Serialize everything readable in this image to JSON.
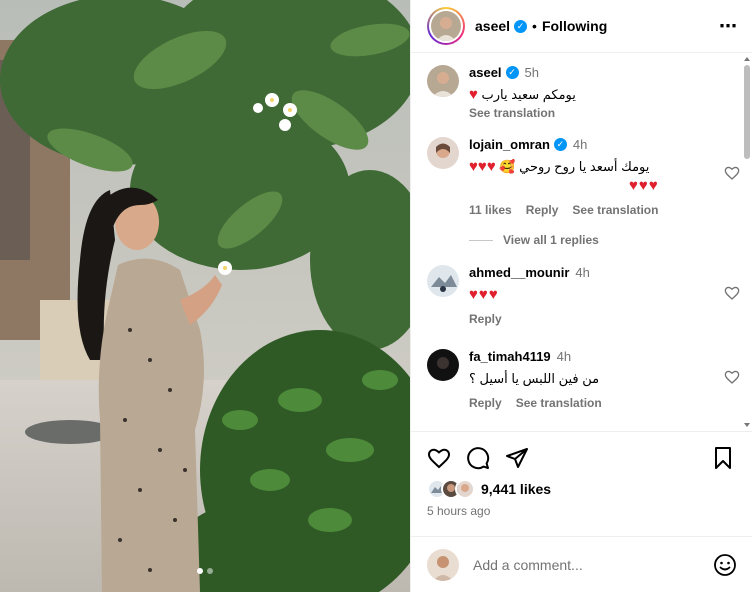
{
  "post": {
    "username": "aseel",
    "verified": true,
    "separator": "•",
    "follow_status": "Following",
    "more_icon": "more-horizontal-icon"
  },
  "comments": [
    {
      "user": "aseel",
      "time": "5h",
      "text": "يومكم سعيد يارب",
      "hearts": "♥",
      "meta": {
        "see_translation": "See translation"
      }
    },
    {
      "user": "lojain_omran",
      "time": "4h",
      "text": "يومك أسعد يا روح روحي 🥰",
      "hearts_inline": "♥♥♥",
      "hearts": "♥♥♥",
      "meta": {
        "likes": "11 likes",
        "reply": "Reply",
        "see_translation": "See translation"
      },
      "view_replies": "View all 1 replies"
    },
    {
      "user": "ahmed__mounir",
      "time": "4h",
      "text": "",
      "hearts": "♥♥♥",
      "meta": {
        "reply": "Reply"
      }
    },
    {
      "user": "fa_timah4119",
      "time": "4h",
      "text": "من فين اللبس يا أسيل ؟",
      "meta": {
        "reply": "Reply",
        "see_translation": "See translation"
      }
    }
  ],
  "actions": {
    "like_icon": "heart-outline-icon",
    "comment_icon": "comment-bubble-icon",
    "share_icon": "paper-plane-icon",
    "save_icon": "bookmark-icon"
  },
  "likes": {
    "count_text": "9,441 likes"
  },
  "time_ago": "5 hours ago",
  "add_comment": {
    "placeholder": "Add a comment..."
  },
  "carousel": {
    "total": 2,
    "active": 1
  },
  "colors": {
    "accent": "#0095f6",
    "heart": "#e0202c",
    "muted": "#737373"
  }
}
